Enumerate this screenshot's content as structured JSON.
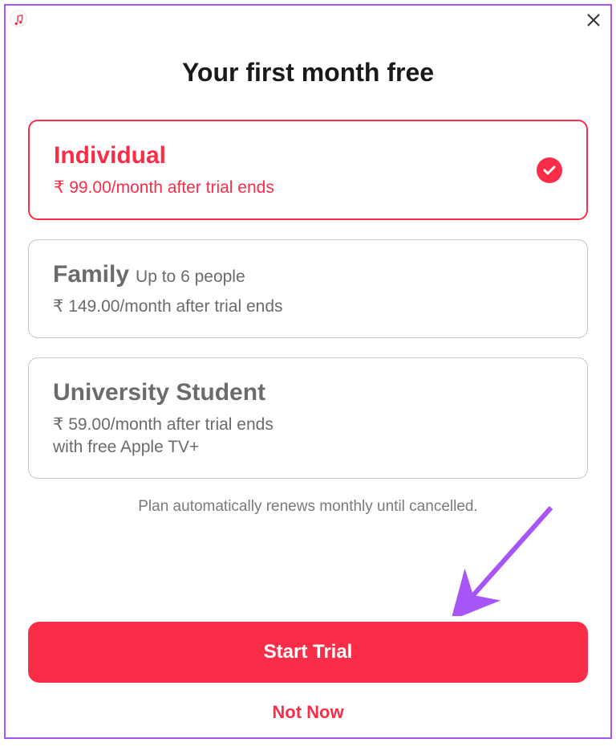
{
  "heading": "Your first month free",
  "plans": [
    {
      "title": "Individual",
      "subtitle": "",
      "price": "₹ 99.00/month after trial ends",
      "extra": "",
      "selected": true
    },
    {
      "title": "Family",
      "subtitle": "Up to 6 people",
      "price": "₹ 149.00/month after trial ends",
      "extra": "",
      "selected": false
    },
    {
      "title": "University Student",
      "subtitle": "",
      "price": "₹ 59.00/month after trial ends",
      "extra": "with free Apple TV+",
      "selected": false
    }
  ],
  "renewal_note": "Plan automatically renews monthly until cancelled.",
  "start_button": "Start Trial",
  "not_now": "Not Now"
}
